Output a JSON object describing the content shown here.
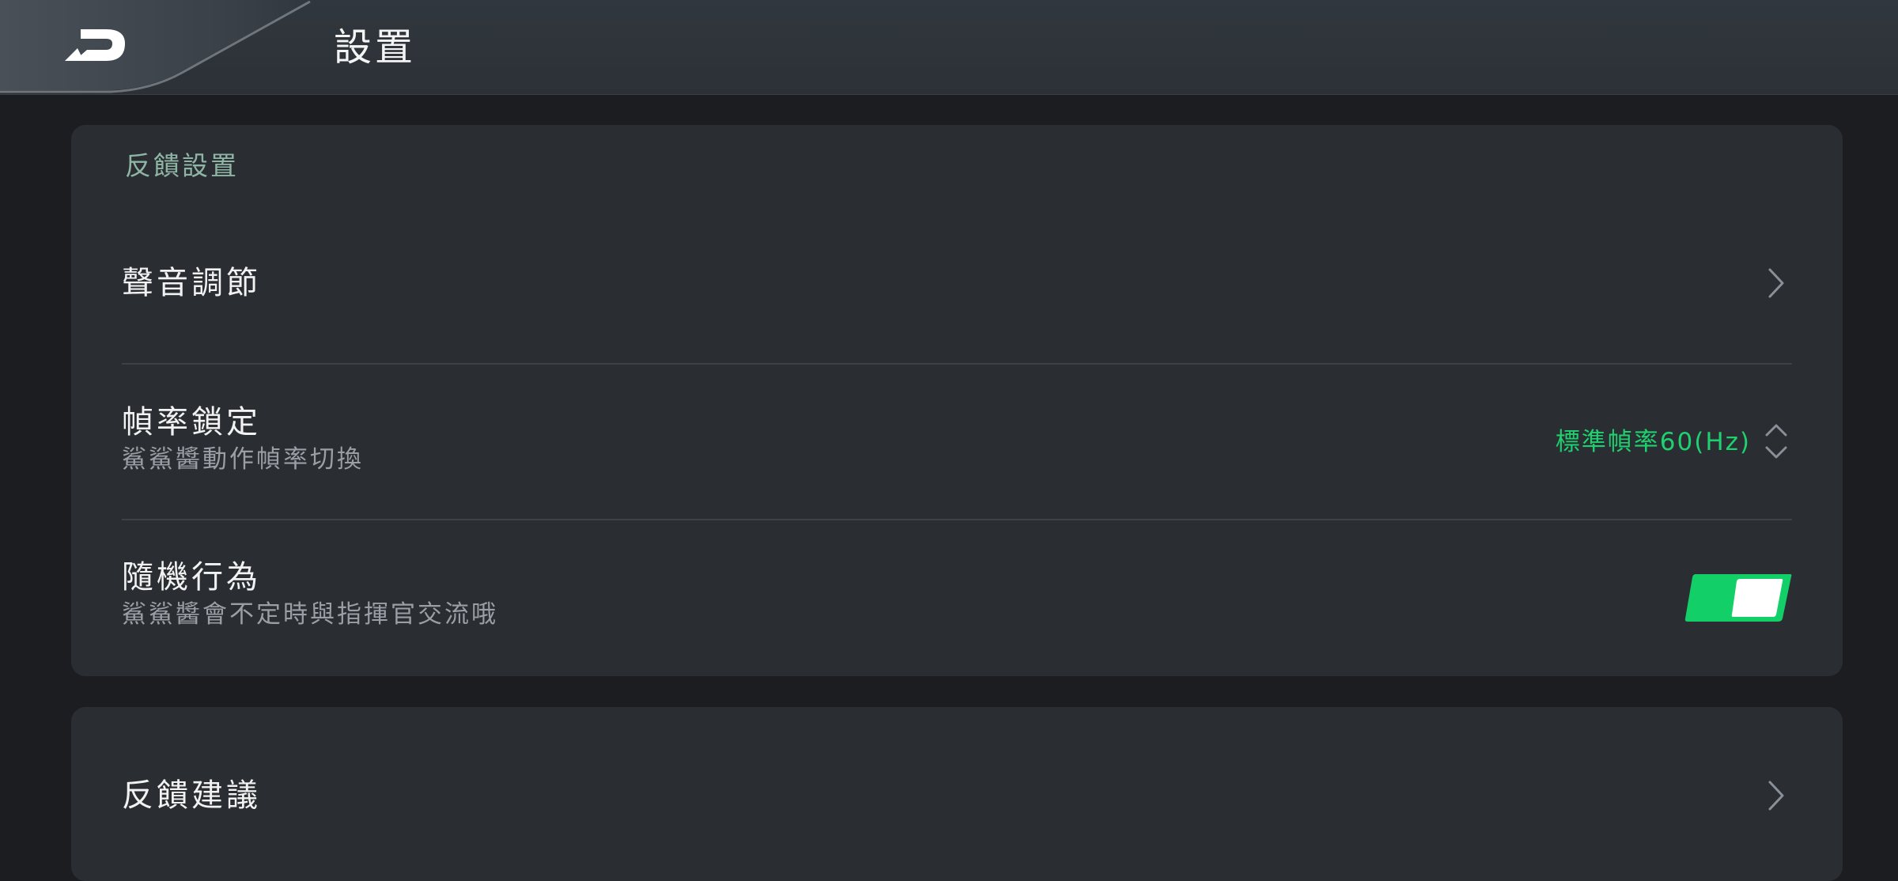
{
  "header": {
    "back_icon": "back-arrow-icon",
    "title": "設置"
  },
  "feedback_settings": {
    "section_label": "反饋設置",
    "sound": {
      "title": "聲音調節",
      "icon": "chevron-right-icon"
    },
    "frame_rate": {
      "title": "幀率鎖定",
      "subtitle": "鯊鯊醬動作幀率切換",
      "value": "標準幀率60(Hz)",
      "icon": "chevron-up-down-icon"
    },
    "random_behavior": {
      "title": "隨機行為",
      "subtitle": "鯊鯊醬會不定時與指揮官交流哦",
      "enabled": true
    }
  },
  "feedback": {
    "title": "反饋建議",
    "icon": "chevron-right-icon"
  },
  "colors": {
    "accent": "#1fd16e",
    "section_label": "#8fb5a5",
    "card": "#2a2e33",
    "background": "#1b1d20",
    "header": "#2f353c"
  }
}
